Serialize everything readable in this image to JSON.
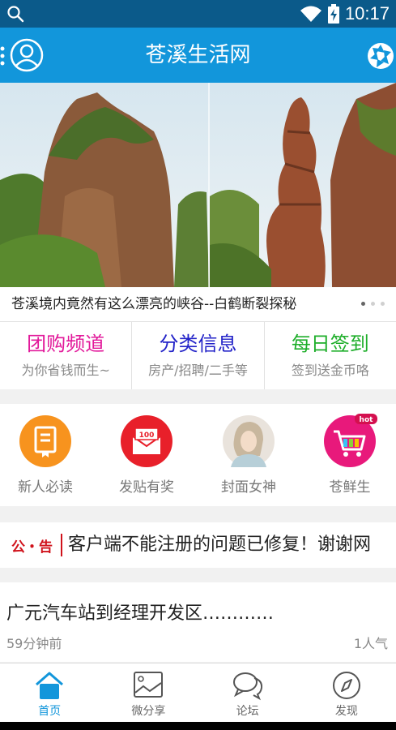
{
  "status_bar": {
    "time": "10:17"
  },
  "app_bar": {
    "title": "苍溪生活网"
  },
  "banner": {
    "caption": "苍溪境内竟然有这么漂亮的峡谷--白鹤断裂探秘",
    "slide_count": 3,
    "active_slide": 1
  },
  "channels": [
    {
      "title": "团购频道",
      "subtitle": "为你省钱而生~",
      "color": "#e2189a"
    },
    {
      "title": "分类信息",
      "subtitle": "房产/招聘/二手等",
      "color": "#2222c8"
    },
    {
      "title": "每日签到",
      "subtitle": "签到送金币咯",
      "color": "#1eae2a"
    }
  ],
  "shortcuts": [
    {
      "label": "新人必读",
      "icon": "book-icon",
      "color": "#f7931e"
    },
    {
      "label": "发贴有奖",
      "icon": "money-envelope-icon",
      "color": "#e8202a"
    },
    {
      "label": "封面女神",
      "icon": "cover-girl-photo"
    },
    {
      "label": "苍鲜生",
      "icon": "shopping-cart-icon",
      "color": "#e8197b",
      "badge": "hot"
    }
  ],
  "notice": {
    "tag": "公・告",
    "message": "客户端不能注册的问题已修复！谢谢网"
  },
  "post": {
    "title": "广元汽车站到经理开发区…………",
    "time": "59分钟前",
    "views": "1人气"
  },
  "tabs": [
    {
      "label": "首页",
      "icon": "home-icon",
      "active": true
    },
    {
      "label": "微分享",
      "icon": "image-icon",
      "active": false
    },
    {
      "label": "论坛",
      "icon": "chat-bubbles-icon",
      "active": false
    },
    {
      "label": "发现",
      "icon": "compass-icon",
      "active": false
    }
  ],
  "colors": {
    "accent": "#1296db",
    "status_bar": "#0b5a8a",
    "notice_red": "#d0121b"
  }
}
